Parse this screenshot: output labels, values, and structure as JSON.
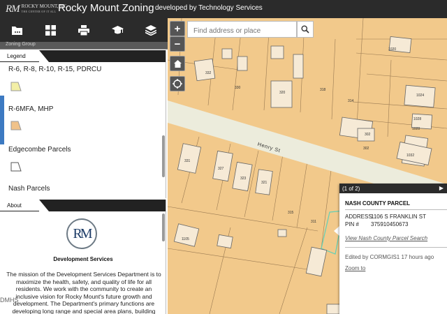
{
  "header": {
    "logo_mark": "RM",
    "logo_line1": "ROCKY MOUNT, NC",
    "logo_line2": "THE CENTER OF IT ALL",
    "title": "Rocky Mount Zoning",
    "subtitle": "developed by Technology Services"
  },
  "toolbar": {
    "items": [
      {
        "icon": "folder-icon"
      },
      {
        "icon": "grid-icon"
      },
      {
        "icon": "printer-icon"
      },
      {
        "icon": "graduation-cap-icon"
      },
      {
        "icon": "layers-icon"
      }
    ],
    "group_label": "Zoning Group"
  },
  "legend": {
    "tab_label": "Legend",
    "items": [
      {
        "label": "R-6, R-8, R-10, R-15, PDRCU",
        "swatch_color": "#f3efa6",
        "swatch_stroke": "#999999"
      },
      {
        "label": "R-6MFA, MHP",
        "swatch_color": "#f0c28a",
        "swatch_stroke": "#999999"
      },
      {
        "label": "Edgecombe Parcels",
        "swatch_color": "#ffffff",
        "swatch_stroke": "#555555"
      },
      {
        "label": "Nash Parcels",
        "swatch_color": "#ffffff",
        "swatch_stroke": "#555555"
      }
    ]
  },
  "about": {
    "tab_label": "About",
    "logo_text": "RM",
    "heading": "Development Services",
    "text": "The mission of the Development Services Department is to maximize the health, safety, and quality of life for all residents. We work with the community to create an inclusive vision for Rocky Mount's future growth and development. The Department's primary functions are developing long range and special area plans, building"
  },
  "watermark": "DMHS",
  "map": {
    "zoom_in": "+",
    "zoom_out": "−",
    "search_placeholder": "Find address or place",
    "street_name": "Henry St",
    "parcel_labels": [
      "1020",
      "332",
      "330",
      "320",
      "318",
      "1024",
      "314",
      "1028",
      "1028",
      "302",
      "302",
      "1032",
      "331",
      "327",
      "323",
      "321",
      "315",
      "311",
      "1105",
      "1108"
    ]
  },
  "popup": {
    "counter": "(1 of 2)",
    "next": "▶",
    "title": "NASH COUNTY PARCEL",
    "address_key": "ADDRESS",
    "address_val": "1106 S FRANKLIN ST",
    "pin_key": "PIN #",
    "pin_val": "375910450673",
    "view_link": "View Nash County Parcel Search",
    "edited": "Edited by CORMGIS1 17 hours ago",
    "zoom_link": "Zoom to"
  },
  "colors": {
    "header_bg": "#2b2b2b",
    "parcel_fill": "#f2c98b",
    "street_fill": "#ececdc",
    "building_fill": "#f6ead6",
    "accent": "#3d7ac2",
    "highlight_outline": "#5fd0b8"
  }
}
